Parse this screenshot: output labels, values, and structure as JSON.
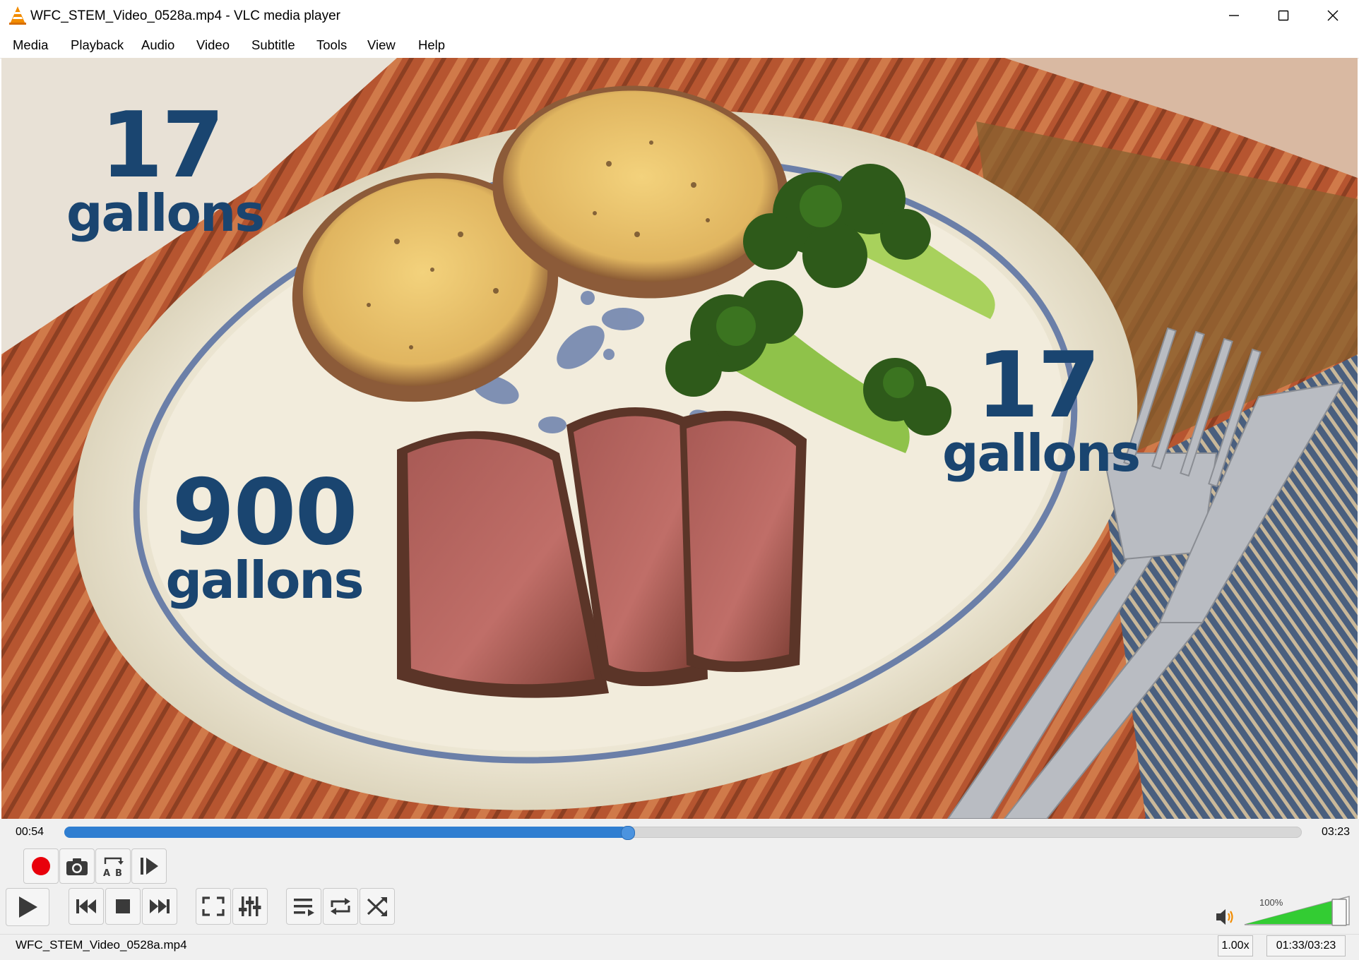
{
  "window": {
    "title": "WFC_STEM_Video_0528a.mp4 - VLC media player",
    "minimize_label": "–",
    "maximize_label": "☐",
    "close_label": "✕"
  },
  "menu": [
    "Media",
    "Playback",
    "Audio",
    "Video",
    "Subtitle",
    "Tools",
    "View",
    "Help"
  ],
  "video": {
    "overlays": [
      {
        "number": "17",
        "unit": "gallons"
      },
      {
        "number": "17",
        "unit": "gallons"
      },
      {
        "number": "900",
        "unit": "gallons"
      }
    ]
  },
  "playback": {
    "elapsed": "00:54",
    "duration": "03:23",
    "progress_fraction": 0.455
  },
  "volume": {
    "percent_label": "100%",
    "level_fraction": 1.0
  },
  "status": {
    "filename": "WFC_STEM_Video_0528a.mp4",
    "speed": "1.00x",
    "time": "01:33/03:23"
  },
  "colors": {
    "seek_fill": "#2f7ed1",
    "record": "#e8000b",
    "volume_fill": "#33cc33",
    "overlay_text": "#1a4570"
  }
}
